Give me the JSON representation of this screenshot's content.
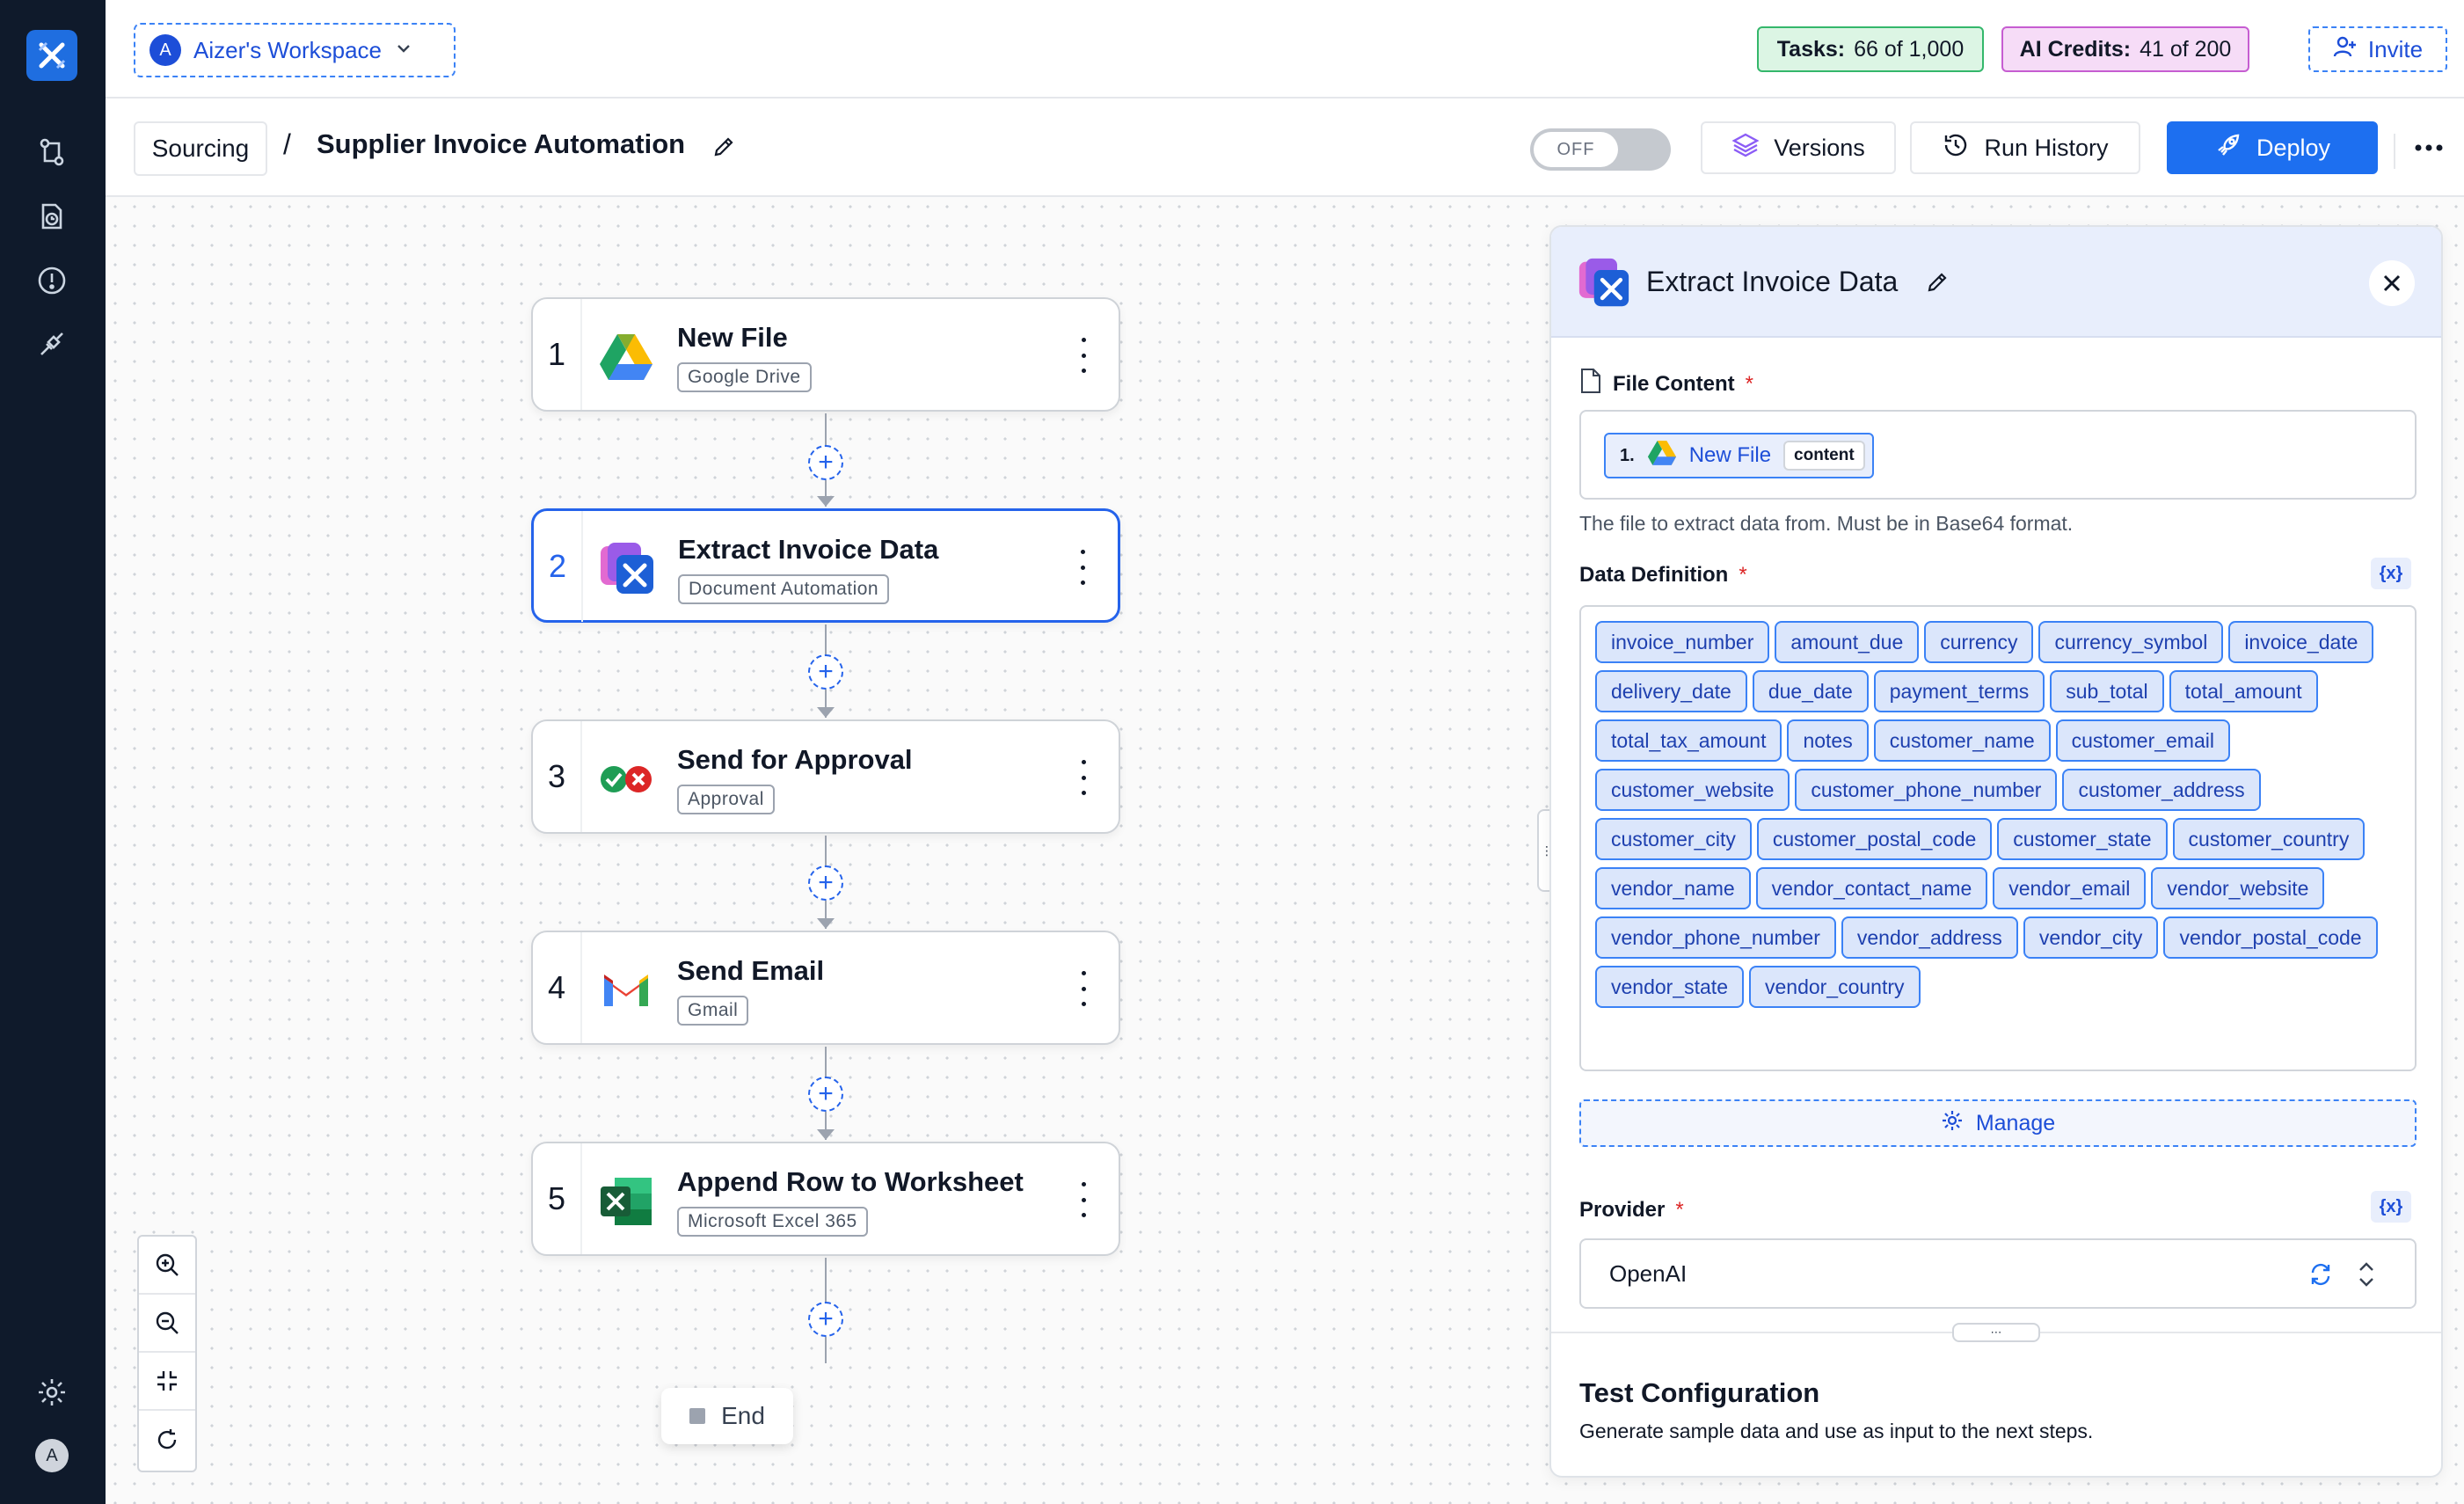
{
  "workspace": {
    "avatar_letter": "A",
    "name": "Aizer's Workspace"
  },
  "usage": {
    "tasks_label": "Tasks:",
    "tasks_value": "66 of 1,000",
    "credits_label": "AI Credits:",
    "credits_value": "41 of 200"
  },
  "invite_label": "Invite",
  "breadcrumb": {
    "parent": "Sourcing",
    "separator": "/",
    "title": "Supplier Invoice Automation"
  },
  "toolbar": {
    "toggle_label": "OFF",
    "versions_label": "Versions",
    "run_history_label": "Run History",
    "deploy_label": "Deploy"
  },
  "flow": {
    "nodes": [
      {
        "num": "1",
        "title": "New File",
        "tag": "Google Drive",
        "icon": "google-drive-icon"
      },
      {
        "num": "2",
        "title": "Extract Invoice Data",
        "tag": "Document Automation",
        "icon": "document-automation-icon"
      },
      {
        "num": "3",
        "title": "Send for Approval",
        "tag": "Approval",
        "icon": "approval-icon"
      },
      {
        "num": "4",
        "title": "Send Email",
        "tag": "Gmail",
        "icon": "gmail-icon"
      },
      {
        "num": "5",
        "title": "Append Row to Worksheet",
        "tag": "Microsoft Excel 365",
        "icon": "excel-icon"
      }
    ],
    "end_label": "End"
  },
  "panel": {
    "title": "Extract Invoice Data",
    "file_content_label": "File Content",
    "required_mark": "*",
    "file_chip": {
      "step": "1.",
      "name": "New File",
      "field": "content"
    },
    "file_help": "The file to extract data from. Must be in Base64 format.",
    "data_definition_label": "Data Definition",
    "fx_label": "{x}",
    "fields": [
      "invoice_number",
      "amount_due",
      "currency",
      "currency_symbol",
      "invoice_date",
      "delivery_date",
      "due_date",
      "payment_terms",
      "sub_total",
      "total_amount",
      "total_tax_amount",
      "notes",
      "customer_name",
      "customer_email",
      "customer_website",
      "customer_phone_number",
      "customer_address",
      "customer_city",
      "customer_postal_code",
      "customer_state",
      "customer_country",
      "vendor_name",
      "vendor_contact_name",
      "vendor_email",
      "vendor_website",
      "vendor_phone_number",
      "vendor_address",
      "vendor_city",
      "vendor_postal_code",
      "vendor_state",
      "vendor_country"
    ],
    "manage_label": "Manage",
    "provider_label": "Provider",
    "provider_value": "OpenAI",
    "test_title": "Test Configuration",
    "test_desc": "Generate sample data and use as input to the next steps."
  },
  "rail_avatar_letter": "A",
  "colors": {
    "accent": "#1d6ff0",
    "rail": "#0f1a2b",
    "tasks_bg": "#dcf5e4",
    "credits_bg": "#f6dcf7"
  }
}
